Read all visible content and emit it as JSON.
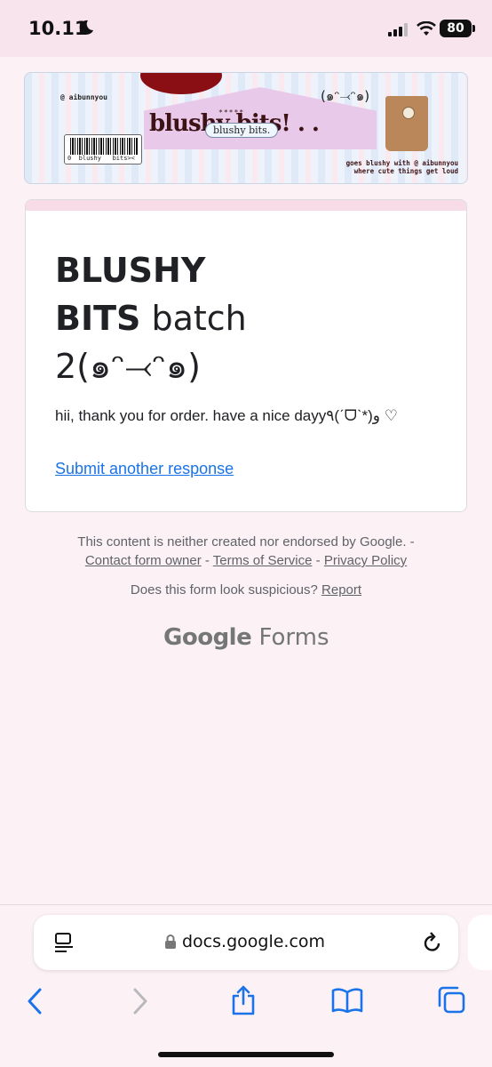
{
  "status": {
    "time": "10.11",
    "battery": "80"
  },
  "banner": {
    "handle": "@ aibunnyou",
    "kaomoji": "(๑ᵔ⤙ᵔ๑)",
    "stars": "*****",
    "title": "blushy bits! . .",
    "pill": "blushy bits.",
    "barcode_text": "0  blushy   bits><",
    "sub_line1": "goes blushy with @ aibunnyou",
    "sub_line2": "where cute things get loud"
  },
  "card": {
    "title_bold": "BLUSHY BITS",
    "title_rest": " batch 2(๑ᵔ⤙ᵔ๑)",
    "message": "hii, thank you for order. have a nice dayy٩(ˊᗜˋ*)و ♡",
    "link": "Submit another response"
  },
  "footer": {
    "disclaimer": "This content is neither created nor endorsed by Google. -",
    "contact": "Contact form owner",
    "terms": "Terms of Service",
    "privacy": "Privacy Policy",
    "sep": " - ",
    "suspicious": "Does this form look suspicious?",
    "report": "Report",
    "brand_google": "Google",
    "brand_forms": "Forms"
  },
  "browser": {
    "url": "docs.google.com"
  },
  "icons": [
    "moon-icon",
    "signal-icon",
    "wifi-icon",
    "reader-icon",
    "lock-icon",
    "reload-icon",
    "back-icon",
    "forward-icon",
    "share-icon",
    "bookmarks-icon",
    "tabs-icon"
  ]
}
